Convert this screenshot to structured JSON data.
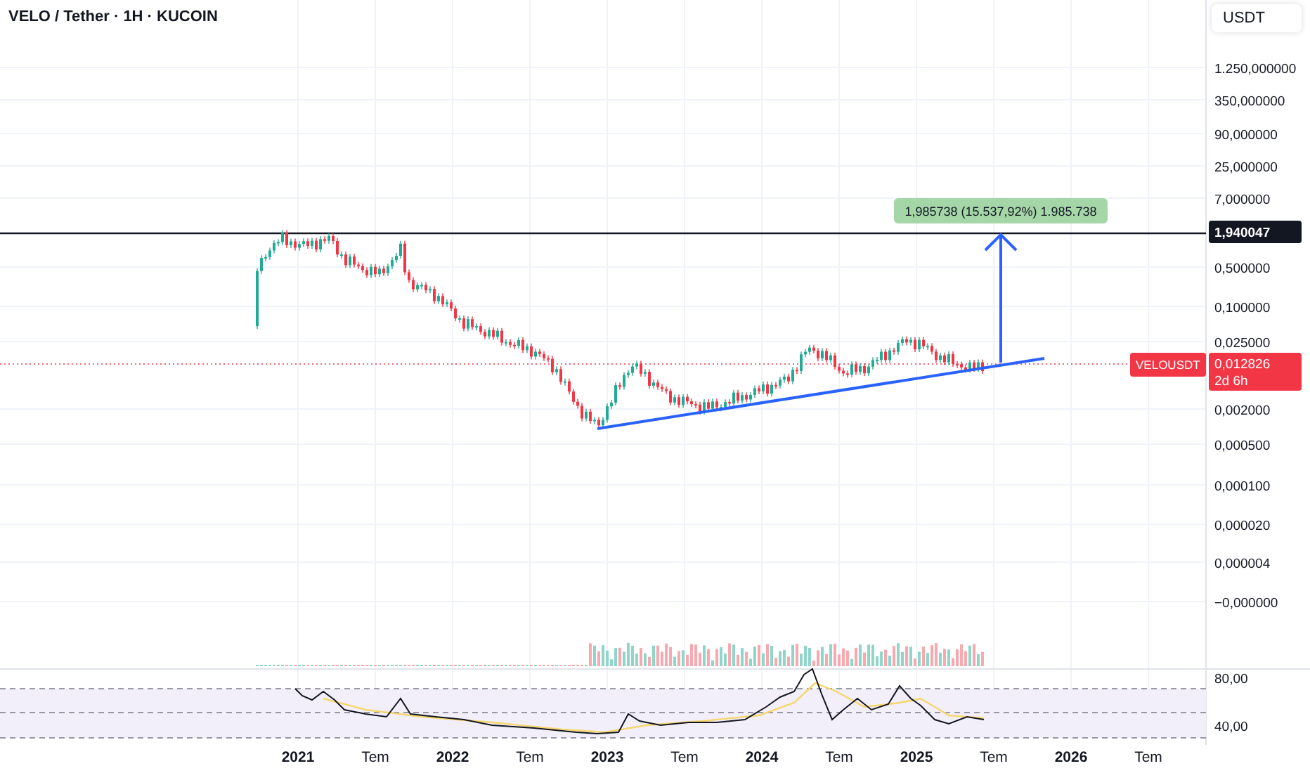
{
  "title": "VELO / Tether · 1H · KUCOIN",
  "currency_button": "USDT",
  "price_axis": [
    "1.250,000000",
    "350,000000",
    "90,000000",
    "25,000000",
    "7,000000",
    "0,500000",
    "0,100000",
    "0,025000",
    "0,002000",
    "0,000500",
    "0,000100",
    "0,000020",
    "0,000004",
    "−0,000000"
  ],
  "level_line_label": "1,940047",
  "current_price": {
    "symbol": "VELOUSDT",
    "price": "0,012826",
    "countdown": "2d 6h"
  },
  "measurement_label": "1,985738 (15.537,92%) 1.985.738",
  "rsi_axis": [
    "80,00",
    "40,00"
  ],
  "time_axis": [
    {
      "label": "2021",
      "kind": "year"
    },
    {
      "label": "Tem",
      "kind": "month"
    },
    {
      "label": "2022",
      "kind": "year"
    },
    {
      "label": "Tem",
      "kind": "month"
    },
    {
      "label": "2023",
      "kind": "year"
    },
    {
      "label": "Tem",
      "kind": "month"
    },
    {
      "label": "2024",
      "kind": "year"
    },
    {
      "label": "Tem",
      "kind": "month"
    },
    {
      "label": "2025",
      "kind": "year"
    },
    {
      "label": "Tem",
      "kind": "month"
    },
    {
      "label": "2026",
      "kind": "year"
    },
    {
      "label": "Tem",
      "kind": "month"
    }
  ]
}
